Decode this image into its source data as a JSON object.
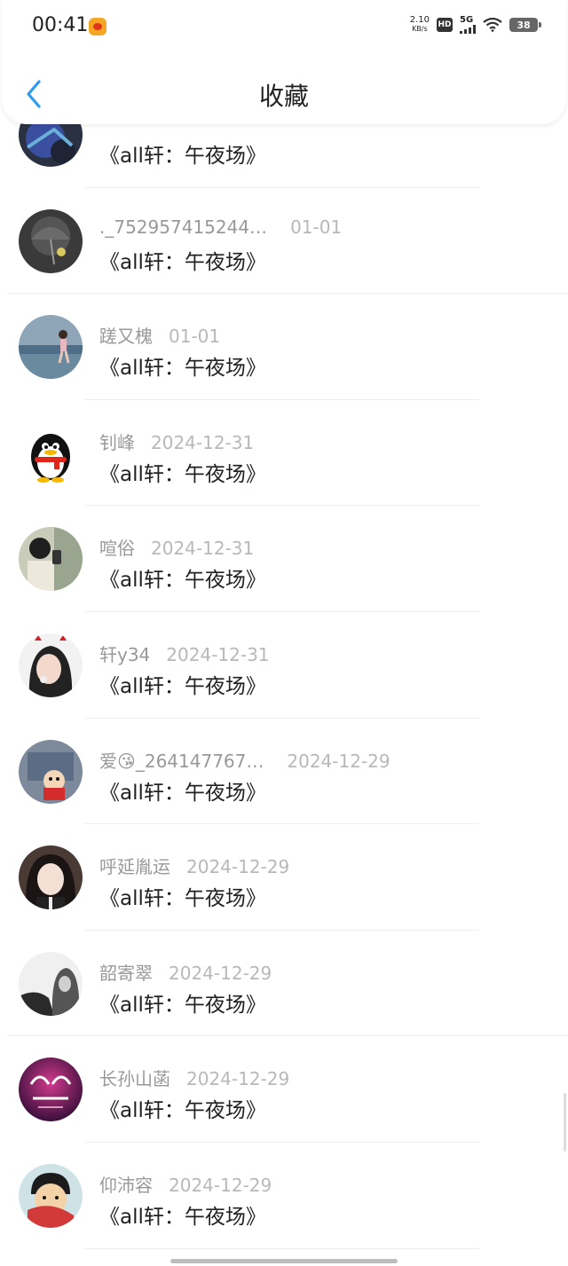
{
  "status_bar": {
    "time": "00:41",
    "net_speed_value": "2.10",
    "net_speed_unit": "KB/s",
    "hd_label": "HD",
    "network_label": "5G",
    "battery_level": "38"
  },
  "header": {
    "title": "收藏",
    "back_icon": "chevron-left-icon",
    "accent_color": "#2e9bf0"
  },
  "items": [
    {
      "user": "",
      "date": "",
      "title": "《all轩：午夜场》"
    },
    {
      "user": "._752957415244…",
      "date": "01-01",
      "title": "《all轩：午夜场》"
    },
    {
      "user": "蹉又槐",
      "date": "01-01",
      "title": "《all轩：午夜场》"
    },
    {
      "user": "钊峰",
      "date": "2024-12-31",
      "title": "《all轩：午夜场》"
    },
    {
      "user": "喧俗",
      "date": "2024-12-31",
      "title": "《all轩：午夜场》"
    },
    {
      "user": "轩y34",
      "date": "2024-12-31",
      "title": "《all轩：午夜场》"
    },
    {
      "user": "爱😘_264147767…",
      "date": "2024-12-29",
      "title": "《all轩：午夜场》"
    },
    {
      "user": "呼延胤运",
      "date": "2024-12-29",
      "title": "《all轩：午夜场》"
    },
    {
      "user": "韶寄翠",
      "date": "2024-12-29",
      "title": "《all轩：午夜场》"
    },
    {
      "user": "长孙山菡",
      "date": "2024-12-29",
      "title": "《all轩：午夜场》"
    },
    {
      "user": "仰沛容",
      "date": "2024-12-29",
      "title": "《all轩：午夜场》"
    }
  ]
}
